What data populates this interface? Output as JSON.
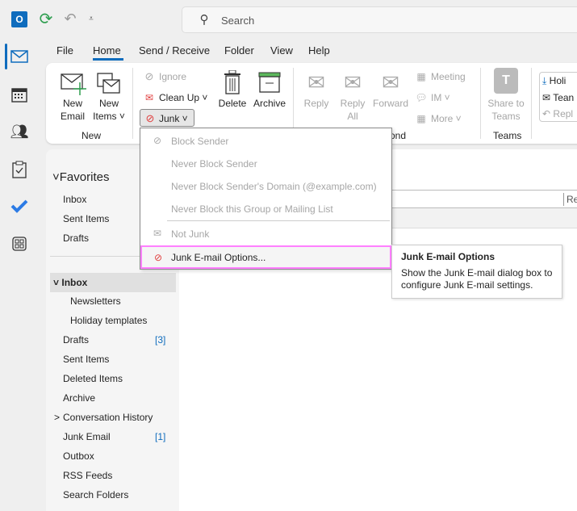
{
  "titlebar": {
    "search_placeholder": "Search"
  },
  "menu_tabs": [
    "File",
    "Home",
    "Send / Receive",
    "Folder",
    "View",
    "Help"
  ],
  "ribbon": {
    "new_email": [
      "New",
      "Email"
    ],
    "new_items": [
      "New",
      "Items ˅"
    ],
    "group_new": "New",
    "ignore": "Ignore",
    "clean_up": "Clean Up ˅",
    "junk": "Junk ˅",
    "delete": "Delete",
    "archive": "Archive",
    "reply": "Reply",
    "reply_all": [
      "Reply",
      "All"
    ],
    "forward": "Forward",
    "meeting": "Meeting",
    "im": "IM ˅",
    "more": "More ˅",
    "group_respond_partial": "ond",
    "share_teams": [
      "Share to",
      "Teams"
    ],
    "group_teams": "Teams",
    "quick_steps": [
      "Holi",
      "Tean",
      "Repl"
    ]
  },
  "junk_menu": {
    "items": [
      "Block Sender",
      "Never Block Sender",
      "Never Block Sender's Domain (@example.com)",
      "Never Block this Group or Mailing List",
      "Not Junk",
      "Junk E-mail Options..."
    ]
  },
  "tooltip": {
    "title": "Junk E-mail Options",
    "body": "Show the Junk E-mail dialog box to configure Junk E-mail settings."
  },
  "folders": {
    "favorites_label": "Favorites",
    "favorites": [
      "Inbox",
      "Sent Items",
      "Drafts"
    ],
    "inbox_label": "Inbox",
    "items": [
      {
        "label": "Newsletters",
        "sub": true
      },
      {
        "label": "Holiday templates",
        "sub": true
      },
      {
        "label": "Drafts",
        "count": "[3]"
      },
      {
        "label": "Sent Items"
      },
      {
        "label": "Deleted Items"
      },
      {
        "label": "Archive"
      },
      {
        "label": "Conversation History",
        "chevron": ">"
      },
      {
        "label": "Junk Email",
        "count": "[1]"
      },
      {
        "label": "Outbox"
      },
      {
        "label": "RSS Feeds"
      },
      {
        "label": "Search Folders"
      }
    ]
  },
  "main": {
    "column_header_partial": "Re"
  },
  "colors": {
    "accent": "#0f6cbd",
    "highlight": "#ff80ff",
    "disabled": "#a6a6a6"
  }
}
